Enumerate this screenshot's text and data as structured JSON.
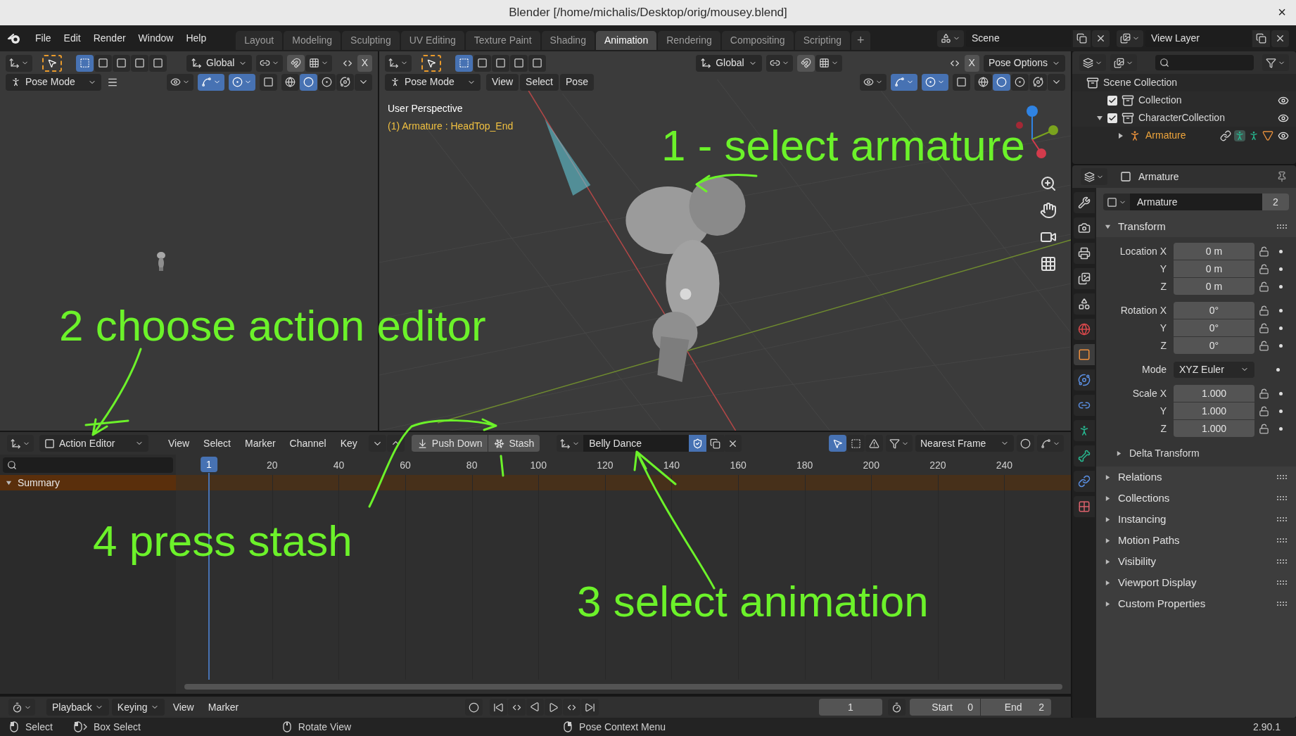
{
  "window": {
    "title": "Blender [/home/michalis/Desktop/orig/mousey.blend]",
    "close": "×"
  },
  "menu": [
    "File",
    "Edit",
    "Render",
    "Window",
    "Help"
  ],
  "workspaces": [
    {
      "label": "Layout",
      "selected": false
    },
    {
      "label": "Modeling",
      "selected": false
    },
    {
      "label": "Sculpting",
      "selected": false
    },
    {
      "label": "UV Editing",
      "selected": false
    },
    {
      "label": "Texture Paint",
      "selected": false
    },
    {
      "label": "Shading",
      "selected": false
    },
    {
      "label": "Animation",
      "selected": true
    },
    {
      "label": "Rendering",
      "selected": false
    },
    {
      "label": "Compositing",
      "selected": false
    },
    {
      "label": "Scripting",
      "selected": false
    }
  ],
  "add_workspace": "+",
  "scene": "Scene",
  "view_layer": "View Layer",
  "left_view": {
    "transform": "Global",
    "x_mirror": "X",
    "mode": "Pose Mode"
  },
  "viewport": {
    "transform": "Global",
    "x_mirror": "X",
    "pose_options": "Pose Options",
    "mode": "Pose Mode",
    "menus": [
      "View",
      "Select",
      "Pose"
    ],
    "perspective": "User Perspective",
    "active": "(1) Armature : HeadTop_End"
  },
  "outliner": {
    "items": [
      {
        "name": "Scene Collection",
        "kind": "scene",
        "children": [
          {
            "name": "Collection",
            "kind": "collection",
            "checked": true,
            "selected": false
          },
          {
            "name": "CharacterCollection",
            "kind": "collection",
            "checked": true,
            "expanded": true,
            "selected": false,
            "children": [
              {
                "name": "Armature",
                "kind": "armature",
                "expanded": false,
                "selected": true
              }
            ]
          }
        ]
      }
    ]
  },
  "properties": {
    "object": "Armature",
    "data_name": "Armature",
    "users": "2",
    "tabs": [
      {
        "kind": "tool",
        "selected": false
      },
      {
        "kind": "render",
        "selected": false
      },
      {
        "kind": "output",
        "selected": false
      },
      {
        "kind": "view_layer",
        "selected": false
      },
      {
        "kind": "scene",
        "selected": false
      },
      {
        "kind": "world",
        "selected": false
      },
      {
        "kind": "object",
        "selected": true
      },
      {
        "kind": "physics",
        "selected": false
      },
      {
        "kind": "constraints",
        "selected": false
      },
      {
        "kind": "armature",
        "selected": false
      },
      {
        "kind": "bone",
        "selected": false
      },
      {
        "kind": "bone_constraints",
        "selected": false
      },
      {
        "kind": "texture",
        "selected": false
      }
    ],
    "transform": {
      "label": "Transform",
      "expanded": true,
      "groups": [
        {
          "kind": "fields",
          "rows": [
            {
              "label": "Location X",
              "value": "0 m"
            },
            {
              "label": "Y",
              "value": "0 m"
            },
            {
              "label": "Z",
              "value": "0 m"
            }
          ]
        },
        {
          "kind": "fields",
          "rows": [
            {
              "label": "Rotation X",
              "value": "0°"
            },
            {
              "label": "Y",
              "value": "0°"
            },
            {
              "label": "Z",
              "value": "0°"
            }
          ]
        },
        {
          "kind": "select",
          "label": "Mode",
          "value": "XYZ Euler"
        },
        {
          "kind": "fields",
          "rows": [
            {
              "label": "Scale X",
              "value": "1.000"
            },
            {
              "label": "Y",
              "value": "1.000"
            },
            {
              "label": "Z",
              "value": "1.000"
            }
          ]
        }
      ],
      "subpanels": [
        {
          "label": "Delta Transform",
          "expanded": false
        }
      ]
    },
    "panels": [
      {
        "label": "Relations",
        "expanded": false
      },
      {
        "label": "Collections",
        "expanded": false
      },
      {
        "label": "Instancing",
        "expanded": false
      },
      {
        "label": "Motion Paths",
        "expanded": false
      },
      {
        "label": "Visibility",
        "expanded": false
      },
      {
        "label": "Viewport Display",
        "expanded": false
      },
      {
        "label": "Custom Properties",
        "expanded": false
      }
    ]
  },
  "dopesheet": {
    "editor": "Action Editor",
    "menus": [
      "View",
      "Select",
      "Marker",
      "Channel",
      "Key"
    ],
    "push_down": "Push Down",
    "stash": "Stash",
    "action": "Belly Dance",
    "snapping": "Nearest Frame",
    "current_frame": "1",
    "ruler": [
      "20",
      "40",
      "60",
      "80",
      "100",
      "120",
      "140",
      "160",
      "180",
      "200",
      "220",
      "240"
    ],
    "channels": [
      {
        "name": "Summary",
        "expanded": true
      }
    ]
  },
  "timeline": {
    "menus": [
      {
        "label": "Playback",
        "kind": "dropdown"
      },
      {
        "label": "Keying",
        "kind": "dropdown"
      },
      {
        "label": "View",
        "kind": "menu"
      },
      {
        "label": "Marker",
        "kind": "menu"
      }
    ],
    "frame": "1",
    "start_label": "Start",
    "start": "0",
    "end_label": "End",
    "end": "2"
  },
  "status": {
    "items": [
      {
        "kind": "left",
        "text": "Select"
      },
      {
        "kind": "drag",
        "text": "Box Select"
      },
      {
        "kind": "middle",
        "text": "Rotate View"
      },
      {
        "kind": "right",
        "text": "Pose Context Menu"
      }
    ],
    "version": "2.90.1"
  },
  "annotations": [
    {
      "text": "1 - select armature"
    },
    {
      "text": "2 choose action editor"
    },
    {
      "text": "4 press stash"
    },
    {
      "text": "3 select animation"
    }
  ]
}
